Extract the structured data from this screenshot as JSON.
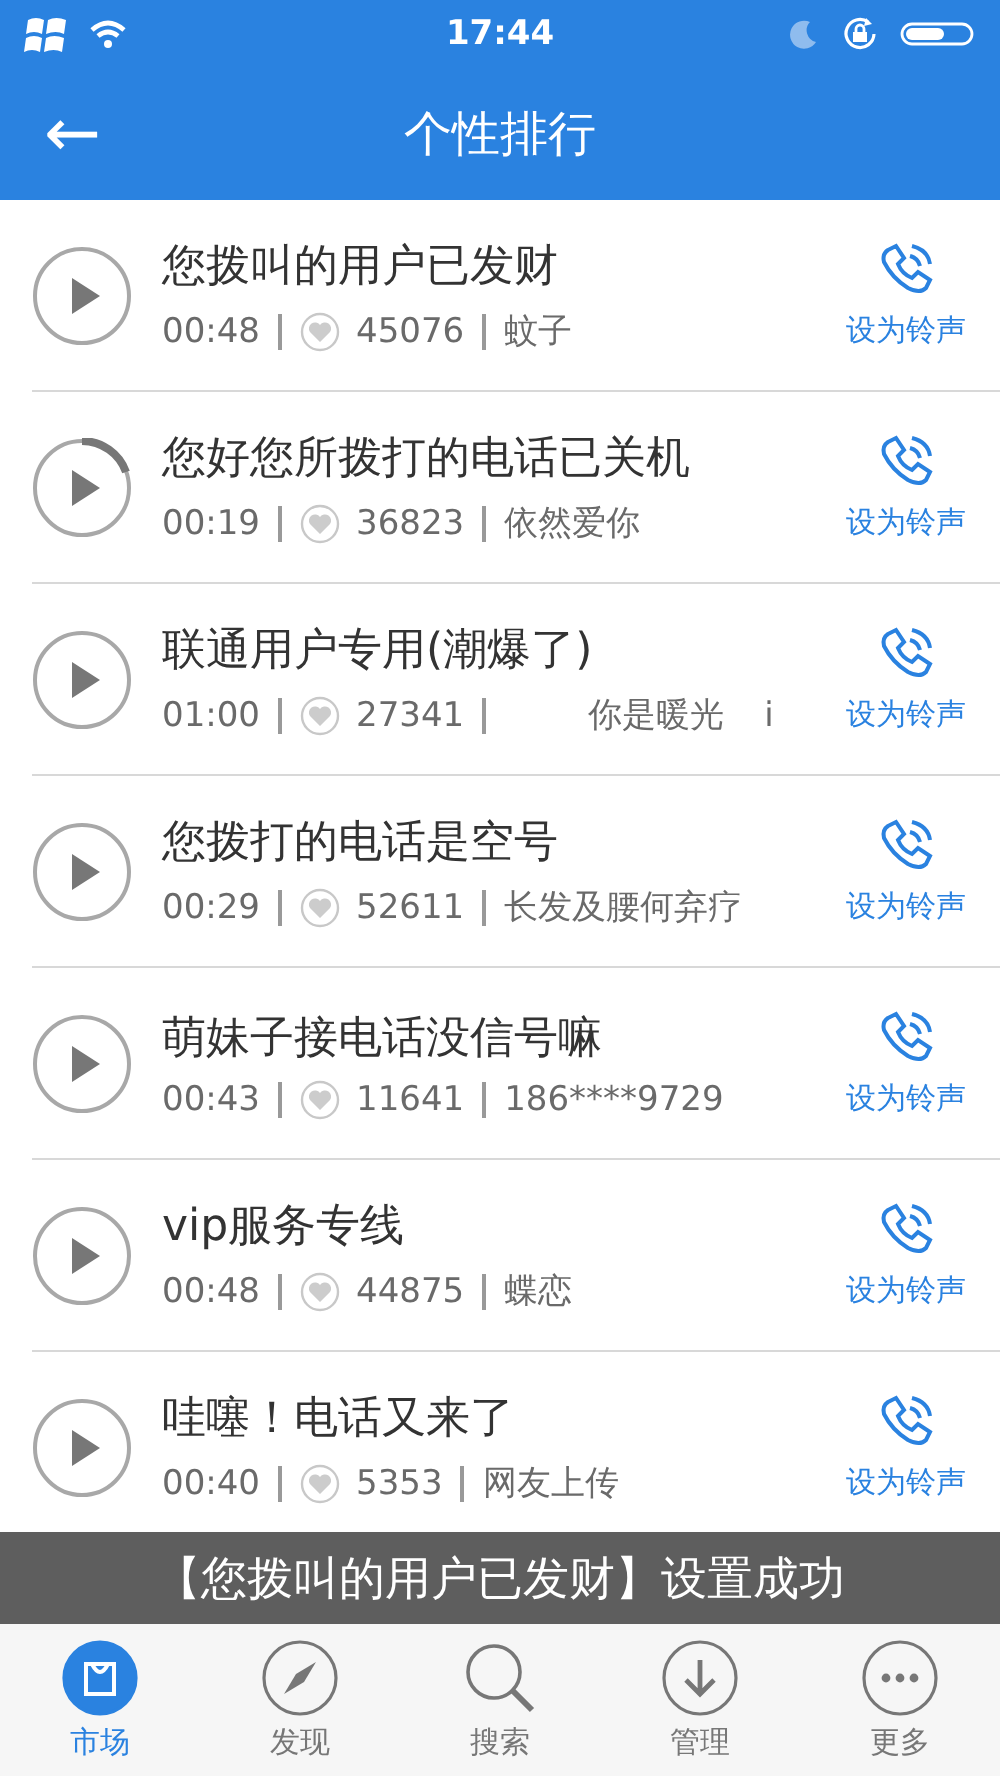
{
  "status_bar": {
    "time": "17:44"
  },
  "header": {
    "back": "←",
    "title": "个性排行"
  },
  "rows": [
    {
      "title": "您拨叫的用户已发财",
      "duration": "00:48",
      "likes": "45076",
      "author": "蚊子",
      "loading": false,
      "action": "设为铃声"
    },
    {
      "title": "您好您所拨打的电话已关机",
      "duration": "00:19",
      "likes": "36823",
      "author": "依然爱你",
      "loading": true,
      "action": "设为铃声"
    },
    {
      "title": "联通用户专用(潮爆了)",
      "duration": "01:00",
      "likes": "27341",
      "author": "你是暖光",
      "extra": "i",
      "loading": false,
      "action": "设为铃声"
    },
    {
      "title": "您拨打的电话是空号",
      "duration": "00:29",
      "likes": "52611",
      "author": "长发及腰何弃疗",
      "loading": false,
      "action": "设为铃声"
    },
    {
      "title": "萌妹子接电话没信号嘛",
      "duration": "00:43",
      "likes": "11641",
      "author": "186****9729",
      "loading": false,
      "action": "设为铃声"
    },
    {
      "title": "vip服务专线",
      "duration": "00:48",
      "likes": "44875",
      "author": "蝶恋",
      "loading": false,
      "action": "设为铃声"
    },
    {
      "title": "哇噻！电话又来了",
      "duration": "00:40",
      "likes": "5353",
      "author": "网友上传",
      "loading": false,
      "action": "设为铃声"
    }
  ],
  "toast": "【您拨叫的用户已发财】设置成功",
  "tabs": [
    {
      "label": "市场",
      "selected": true
    },
    {
      "label": "发现",
      "selected": false
    },
    {
      "label": "搜索",
      "selected": false
    },
    {
      "label": "管理",
      "selected": false
    },
    {
      "label": "更多",
      "selected": false
    }
  ]
}
